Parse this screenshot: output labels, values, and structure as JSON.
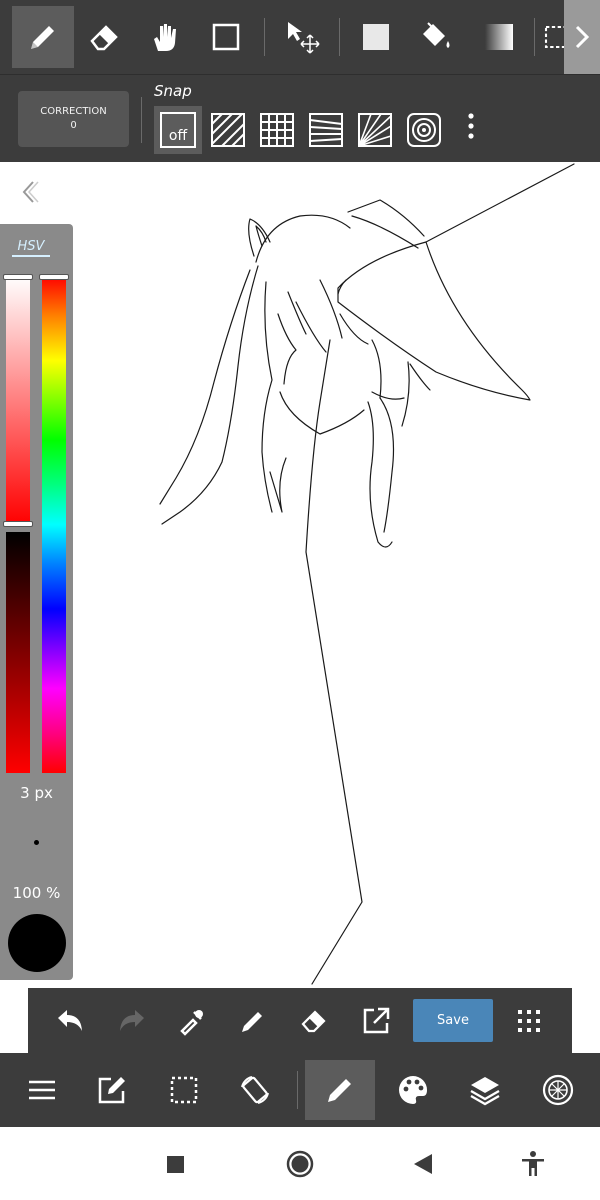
{
  "top_toolbar": {
    "tools": [
      {
        "name": "pen-tool",
        "icon": "pen-icon",
        "active": true
      },
      {
        "name": "eraser-tool",
        "icon": "eraser-icon"
      },
      {
        "name": "hand-tool",
        "icon": "hand-icon"
      },
      {
        "name": "shape-tool",
        "icon": "square-outline-icon"
      },
      {
        "name": "move-tool",
        "icon": "move-icon"
      },
      {
        "name": "fill-color-tool",
        "icon": "filled-square-icon"
      },
      {
        "name": "bucket-tool",
        "icon": "paint-bucket-icon"
      },
      {
        "name": "gradient-tool",
        "icon": "gradient-icon"
      },
      {
        "name": "select-tool",
        "icon": "dashed-select-icon"
      }
    ],
    "more_icon": "chevron-right-icon"
  },
  "sub_toolbar": {
    "correction_label": "CORRECTION",
    "correction_value": "0",
    "snap_label": "Snap",
    "snap_off_label": "off",
    "snap_modes": [
      "parallel-snap-icon",
      "grid-snap-icon",
      "perspective-snap-icon",
      "radial-snap-icon",
      "concentric-snap-icon"
    ],
    "menu_icon": "vertical-dots-icon"
  },
  "color_panel": {
    "mode_tab": "HSV",
    "brush_size": "3 px",
    "opacity": "100 %",
    "current_color": "#000000",
    "saturation_level": 0.5,
    "hue_level": 0.0
  },
  "action_bar": {
    "buttons": [
      "undo-icon",
      "redo-icon",
      "eyedropper-icon",
      "pen-icon",
      "eraser-icon",
      "export-icon"
    ],
    "save_label": "Save",
    "grid_icon": "grid-dots-icon",
    "accent_color": "#4a86b8"
  },
  "bottom_nav": {
    "buttons": [
      "menu-icon",
      "edit-icon",
      "selection-icon",
      "rotate-icon",
      "brush-icon",
      "palette-icon",
      "layers-icon",
      "materials-icon"
    ],
    "active": "brush-icon"
  },
  "system_nav": {
    "buttons": [
      "recents-icon",
      "home-icon",
      "back-icon",
      "accessibility-icon"
    ]
  }
}
